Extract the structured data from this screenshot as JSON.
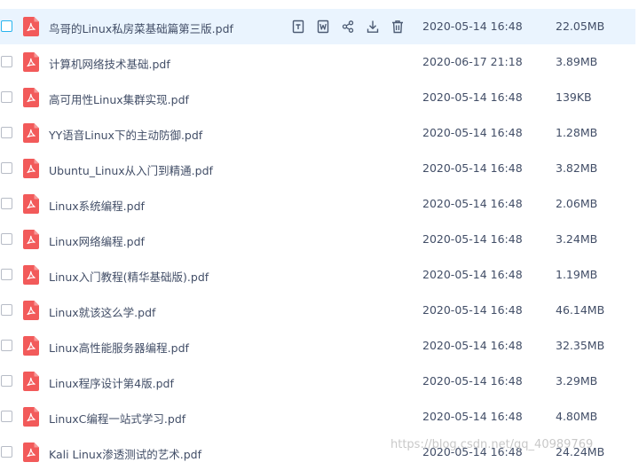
{
  "files": [
    {
      "name": "鸟哥的Linux私房菜基础篇第三版.pdf",
      "modified": "2020-05-14 16:48",
      "size": "22.05MB",
      "hovered": true
    },
    {
      "name": "计算机网络技术基础.pdf",
      "modified": "2020-06-17 21:18",
      "size": "3.89MB"
    },
    {
      "name": "高可用性Linux集群实现.pdf",
      "modified": "2020-05-14 16:48",
      "size": "139KB"
    },
    {
      "name": "YY语音Linux下的主动防御.pdf",
      "modified": "2020-05-14 16:48",
      "size": "1.28MB"
    },
    {
      "name": "Ubuntu_Linux从入门到精通.pdf",
      "modified": "2020-05-14 16:48",
      "size": "3.82MB"
    },
    {
      "name": "Linux系统编程.pdf",
      "modified": "2020-05-14 16:48",
      "size": "2.06MB"
    },
    {
      "name": "Linux网络编程.pdf",
      "modified": "2020-05-14 16:48",
      "size": "3.24MB"
    },
    {
      "name": "Linux入门教程(精华基础版).pdf",
      "modified": "2020-05-14 16:48",
      "size": "1.19MB"
    },
    {
      "name": "Linux就该这么学.pdf",
      "modified": "2020-05-14 16:48",
      "size": "46.14MB"
    },
    {
      "name": "Linux高性能服务器编程.pdf",
      "modified": "2020-05-14 16:48",
      "size": "32.35MB"
    },
    {
      "name": "Linux程序设计第4版.pdf",
      "modified": "2020-05-14 16:48",
      "size": "3.29MB"
    },
    {
      "name": "LinuxC编程一站式学习.pdf",
      "modified": "2020-05-14 16:48",
      "size": "4.80MB"
    },
    {
      "name": "Kali Linux渗透测试的艺术.pdf",
      "modified": "2020-05-14 16:48",
      "size": "24.24MB"
    }
  ],
  "row_actions": [
    {
      "name": "preview-icon"
    },
    {
      "name": "word-convert-icon"
    },
    {
      "name": "share-icon"
    },
    {
      "name": "download-icon"
    },
    {
      "name": "delete-icon"
    }
  ],
  "colors": {
    "hover_background": "#eaf4fe",
    "text": "#424e67",
    "pdf_icon": "#f25a5a",
    "action_icon": "#4c5b73",
    "checkbox_active_border": "#27b4ee"
  },
  "watermark": "https://blog.csdn.net/qq_40989769"
}
